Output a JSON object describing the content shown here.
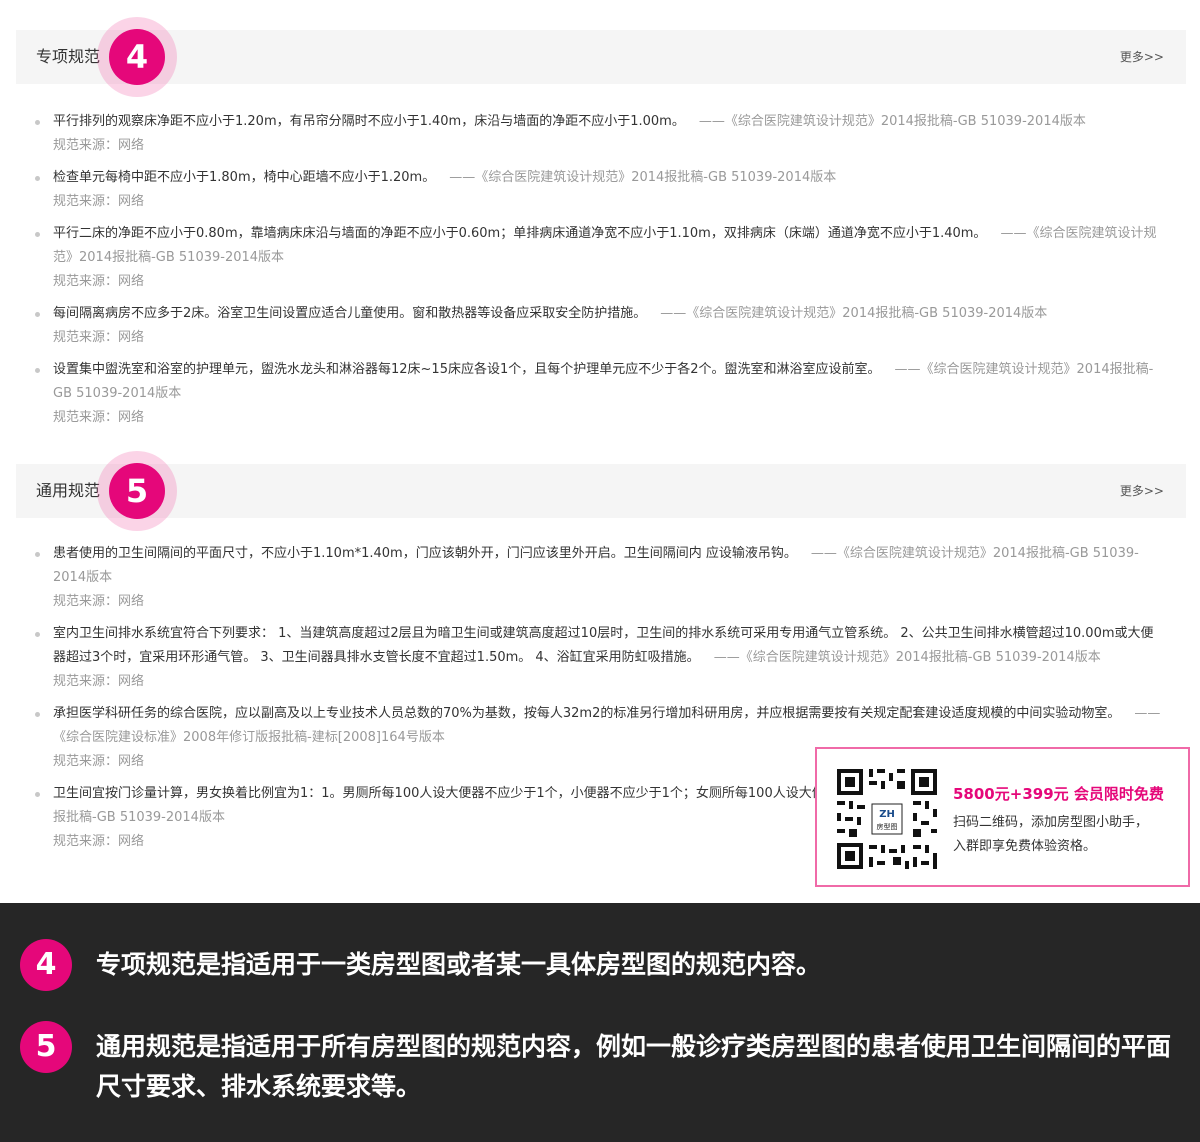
{
  "section4": {
    "title": "专项规范",
    "badge": "4",
    "more": "更多>>",
    "items": [
      {
        "text": "平行排列的观察床净距不应小于1.20m，有吊帘分隔时不应小于1.40m，床沿与墙面的净距不应小于1.00m。",
        "ref": "——《综合医院建筑设计规范》2014报批稿-GB 51039-2014版本",
        "origin": "规范来源：网络"
      },
      {
        "text": "检查单元每椅中距不应小于1.80m，椅中心距墙不应小于1.20m。",
        "ref": "——《综合医院建筑设计规范》2014报批稿-GB 51039-2014版本",
        "origin": "规范来源：网络"
      },
      {
        "text": "平行二床的净距不应小于0.80m，靠墙病床床沿与墙面的净距不应小于0.60m；单排病床通道净宽不应小于1.10m，双排病床（床端）通道净宽不应小于1.40m。",
        "ref": "——《综合医院建筑设计规范》2014报批稿-GB 51039-2014版本",
        "origin": "规范来源：网络"
      },
      {
        "text": "每间隔离病房不应多于2床。浴室卫生间设置应适合儿童使用。窗和散热器等设备应采取安全防护措施。",
        "ref": "——《综合医院建筑设计规范》2014报批稿-GB 51039-2014版本",
        "origin": "规范来源：网络"
      },
      {
        "text": "设置集中盥洗室和浴室的护理单元，盥洗水龙头和淋浴器每12床~15床应各设1个，且每个护理单元应不少于各2个。盥洗室和淋浴室应设前室。",
        "ref": "——《综合医院建筑设计规范》2014报批稿-GB 51039-2014版本",
        "origin": "规范来源：网络"
      }
    ]
  },
  "section5": {
    "title": "通用规范",
    "badge": "5",
    "more": "更多>>",
    "items": [
      {
        "text": "患者使用的卫生间隔间的平面尺寸，不应小于1.10m*1.40m，门应该朝外开，门闩应该里外开启。卫生间隔间内 应设输液吊钩。",
        "ref": "——《综合医院建筑设计规范》2014报批稿-GB 51039-2014版本",
        "origin": "规范来源：网络"
      },
      {
        "text": "室内卫生间排水系统宜符合下列要求： 1、当建筑高度超过2层且为暗卫生间或建筑高度超过10层时，卫生间的排水系统可采用专用通气立管系统。 2、公共卫生间排水横管超过10.00m或大便器超过3个时，宜采用环形通气管。 3、卫生间器具排水支管长度不宜超过1.50m。 4、浴缸宜采用防虹吸措施。",
        "ref": "——《综合医院建筑设计规范》2014报批稿-GB 51039-2014版本",
        "origin": "规范来源：网络"
      },
      {
        "text": "承担医学科研任务的综合医院，应以副高及以上专业技术人员总数的70%为基数，按每人32m2的标准另行增加科研用房，并应根据需要按有关规定配套建设适度规模的中间实验动物室。",
        "ref": "——《综合医院建设标准》2008年修订版报批稿-建标[2008]164号版本",
        "origin": "规范来源：网络"
      },
      {
        "text": "卫生间宜按门诊量计算，男女换着比例宜为1：1。男厕所每100人设大便器不应少于1个，小便器不应少于1个；女厕所每100人设大便器不应少于3个。",
        "ref": "——《综合医院建筑设计规范》2014报批稿-GB 51039-2014版本",
        "origin": "规范来源：网络"
      }
    ]
  },
  "popup": {
    "promo": "5800元+399元 会员限时免费",
    "line1": "扫码二维码，添加房型图小助手，",
    "line2": "入群即享免费体验资格。",
    "qr_logo_top": "ZH",
    "qr_logo_bottom": "房型图"
  },
  "notes": [
    {
      "num": "4",
      "text": "专项规范是指适用于一类房型图或者某一具体房型图的规范内容。"
    },
    {
      "num": "5",
      "text": "通用规范是指适用于所有房型图的规范内容，例如一般诊疗类房型图的患者使用卫生间隔间的平面尺寸要求、排水系统要求等。"
    }
  ],
  "colors": {
    "accent": "#e5077a",
    "footer_bg": "#262626",
    "header_bg": "#f5f5f5"
  }
}
